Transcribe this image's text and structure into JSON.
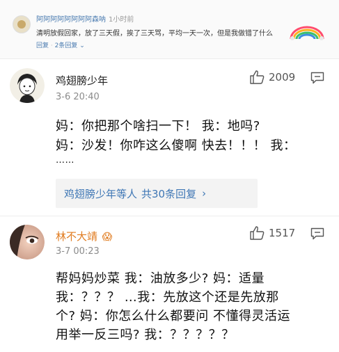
{
  "top_comment": {
    "username": "阿阿阿阿阿阿阿阿森呐",
    "time": "1小时前",
    "text": "清明放假回家，放了三天假，挨了三天骂，平均一天一次，但是我做错了什么",
    "reply_label": "回复",
    "reply_count": "2条回复",
    "reply_chevron": "⌄"
  },
  "comment1": {
    "username": "鸡翅膀少年",
    "time": "3-6 20:40",
    "likes": "2009",
    "lines": [
      "妈：你把那个啥扫一下！   我：地吗?",
      "妈：沙发！你咋这么傻啊 快去！！！   我：",
      "……"
    ],
    "replies": {
      "names": "鸡翅膀少年等人",
      "total": "共30条回复",
      "chevron": "›"
    }
  },
  "comment2": {
    "username": "林不大靖",
    "badge": "😱",
    "time": "3-7 00:23",
    "likes": "1517",
    "lines": [
      "帮妈妈炒菜 我：油放多少? 妈：适量",
      "我：？？？ …我：先放这个还是先放那",
      "个? 妈：你怎么什么都要问 不懂得灵活运",
      "用举一反三吗? 我：？？？？？"
    ]
  },
  "colors": {
    "link_blue": "#3f77b5",
    "username_orange": "#e07b1f",
    "reply_bg": "#f3f3f3"
  }
}
